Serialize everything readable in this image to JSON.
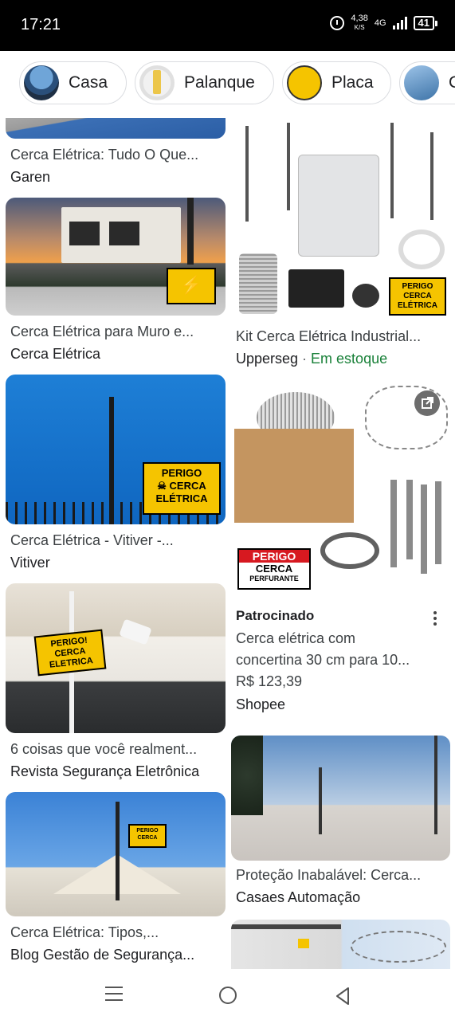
{
  "status": {
    "time": "17:21",
    "speed_value": "4,38",
    "speed_unit": "K/S",
    "network": "4G",
    "battery": "41"
  },
  "chips": [
    {
      "label": "Casa"
    },
    {
      "label": "Palanque"
    },
    {
      "label": "Placa"
    },
    {
      "label": "C"
    }
  ],
  "results": {
    "r1": {
      "title": "Cerca Elétrica: Tudo O Que...",
      "source": "Garen"
    },
    "r2": {
      "title": "Cerca Elétrica para Muro e...",
      "source": "Cerca Elétrica"
    },
    "r3": {
      "title": "Kit Cerca Elétrica Industrial...",
      "source": "Upperseg",
      "separator": " · ",
      "stock": "Em estoque"
    },
    "r4": {
      "title": "Cerca Elétrica - Vitiver -...",
      "source": "Vitiver"
    },
    "r5": {
      "sponsored": "Patrocinado",
      "line1": "Cerca elétrica com",
      "line2": "concertina 30 cm para 10...",
      "price": "R$ 123,39",
      "source": "Shopee"
    },
    "r6": {
      "title": "6 coisas que você realment...",
      "source": "Revista Segurança Eletrônica"
    },
    "r7": {
      "title": "Proteção Inabalável: Cerca...",
      "source": "Casaes Automação"
    },
    "r8": {
      "title": "Cerca Elétrica: Tipos,...",
      "source": "Blog Gestão de Segurança..."
    }
  },
  "signs": {
    "perigo": "PERIGO",
    "cerca": "CERCA",
    "eletrica": "ELÉTRICA",
    "perfurante": "PERFURANTE",
    "perigo_alt": "PERIGO!",
    "eletrica_alt": "ELETRICA"
  },
  "icons": {
    "alarm": "alarm-icon",
    "signal": "signal-icon",
    "battery": "battery-icon",
    "open_external": "open-external-icon",
    "more": "more-vert-icon",
    "nav_recents": "recents-icon",
    "nav_home": "home-icon",
    "nav_back": "back-icon"
  }
}
